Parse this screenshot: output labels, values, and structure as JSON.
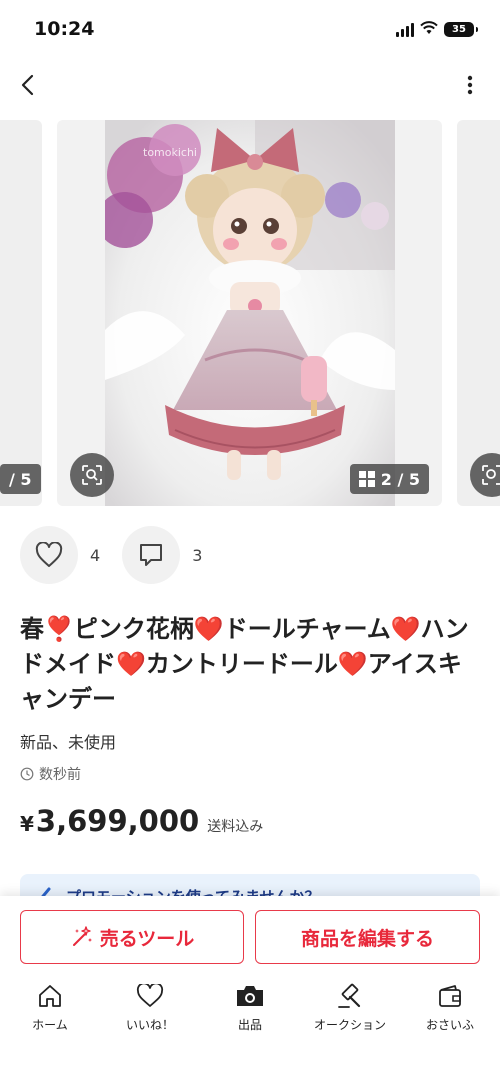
{
  "status_bar": {
    "time": "10:24",
    "battery": "35"
  },
  "carousel": {
    "prev_counter": "/ 5",
    "counter": "2 / 5",
    "watermark": "tomokichi"
  },
  "engagement": {
    "likes": "4",
    "comments": "3"
  },
  "product": {
    "title": "春❣️ピンク花柄❤️ドールチャーム❤️ハンドメイド❤️カントリードール❤️アイスキャンデー",
    "condition": "新品、未使用",
    "posted": "数秒前",
    "currency": "¥",
    "price": "3,699,000",
    "shipping": "送料込み"
  },
  "promo": {
    "text": "プロモーションを使ってみませんか？"
  },
  "actions": {
    "sell_tool": "売るツール",
    "edit": "商品を編集する"
  },
  "tabs": [
    {
      "label": "ホーム",
      "icon": "home-icon"
    },
    {
      "label": "いいね！",
      "icon": "heart-icon"
    },
    {
      "label": "出品",
      "icon": "camera-icon"
    },
    {
      "label": "オークション",
      "icon": "gavel-icon"
    },
    {
      "label": "おさいふ",
      "icon": "wallet-icon"
    }
  ],
  "colors": {
    "accent": "#e8283b",
    "promo_bg": "#e9f2fc",
    "badge_bg": "#464646"
  }
}
